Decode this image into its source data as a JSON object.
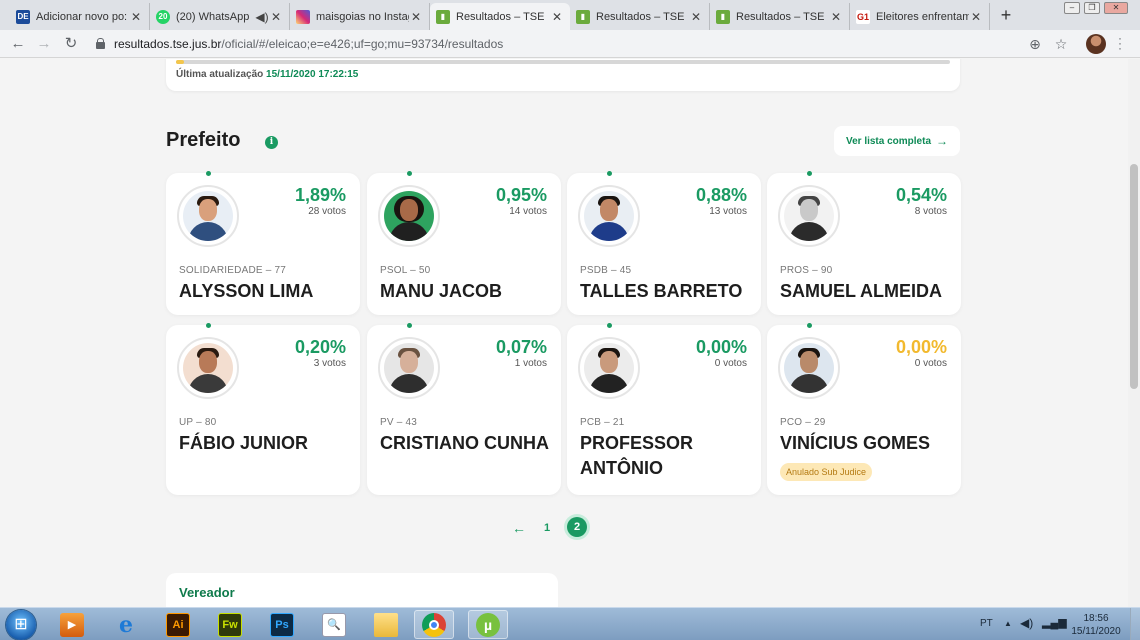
{
  "browser": {
    "tabs": [
      {
        "title": "Adicionar novo po:",
        "favicon": "DE",
        "favicon_color": "#1b4b9a"
      },
      {
        "title": "(20) WhatsApp",
        "favicon": "20",
        "favicon_color": "#25d366"
      },
      {
        "title": "maisgoias no Instag",
        "favicon": "instagram-icon",
        "favicon_color": "#d6249f"
      },
      {
        "title": "Resultados – TSE",
        "favicon": "chart-icon",
        "favicon_color": "#6bab3d",
        "active": true
      },
      {
        "title": "Resultados – TSE",
        "favicon": "chart-icon",
        "favicon_color": "#6bab3d"
      },
      {
        "title": "Resultados – TSE",
        "favicon": "chart-icon",
        "favicon_color": "#6bab3d"
      },
      {
        "title": "Eleitores enfrentam",
        "favicon": "G1",
        "favicon_color": "#c4170c"
      }
    ],
    "new_tab": "+",
    "url_host": "resultados.tse.jus.br",
    "url_path": "/oficial/#/eleicao;e=e426;uf=go;mu=93734/resultados"
  },
  "page": {
    "last_update_label": "Última atualização",
    "last_update_value": "15/11/2020 17:22:15",
    "section_title": "Prefeito",
    "full_list_label": "Ver lista completa",
    "candidates": [
      {
        "pct": "1,89%",
        "votes": "28 votos",
        "party": "SOLIDARIEDADE – 77",
        "name": "ALYSSON LIMA"
      },
      {
        "pct": "0,95%",
        "votes": "14 votos",
        "party": "PSOL – 50",
        "name": "MANU JACOB"
      },
      {
        "pct": "0,88%",
        "votes": "13 votos",
        "party": "PSDB – 45",
        "name": "TALLES BARRETO"
      },
      {
        "pct": "0,54%",
        "votes": "8 votos",
        "party": "PROS – 90",
        "name": "SAMUEL ALMEIDA"
      },
      {
        "pct": "0,20%",
        "votes": "3 votos",
        "party": "UP – 80",
        "name": "FÁBIO JUNIOR"
      },
      {
        "pct": "0,07%",
        "votes": "1 votos",
        "party": "PV – 43",
        "name": "CRISTIANO CUNHA"
      },
      {
        "pct": "0,00%",
        "votes": "0 votos",
        "party": "PCB – 21",
        "name": "PROFESSOR ANTÔNIO"
      },
      {
        "pct": "0,00%",
        "votes": "0 votos",
        "party": "PCO – 29",
        "name": "VINÍCIUS GOMES",
        "badge": "Anulado Sub Judice",
        "pct_color": "yellow"
      }
    ],
    "pager": {
      "prev": "←",
      "page1": "1",
      "page2": "2"
    },
    "vereador_title": "Vereador",
    "colors": {
      "accent": "#1a9a62",
      "warning": "#f2b92e"
    }
  },
  "taskbar": {
    "apps": [
      {
        "name": "media-player-icon",
        "label": ""
      },
      {
        "name": "internet-explorer-icon",
        "label": "e"
      },
      {
        "name": "illustrator-icon",
        "label": "Ai"
      },
      {
        "name": "fireworks-icon",
        "label": "Fw"
      },
      {
        "name": "photoshop-icon",
        "label": "Ps"
      },
      {
        "name": "search-file-icon",
        "label": ""
      },
      {
        "name": "folder-icon",
        "label": ""
      },
      {
        "name": "chrome-icon",
        "label": ""
      },
      {
        "name": "utorrent-icon",
        "label": "µ"
      }
    ],
    "lang": "PT",
    "time": "18:56",
    "date": "15/11/2020"
  }
}
